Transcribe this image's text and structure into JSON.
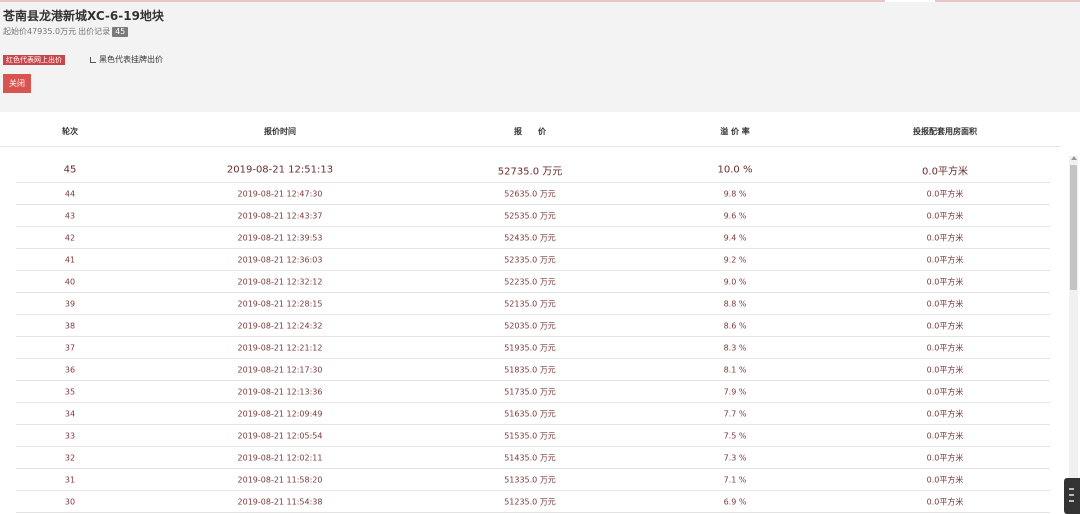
{
  "header": {
    "lot_title": "苍南县龙港新城XC-6-19地块",
    "start_price": "起始价47935.0万元",
    "bid_record_label": "出价记录",
    "bid_count": "45",
    "legend_red": "红色代表网上出价",
    "legend_black": "黑色代表挂牌出价",
    "close_label": "关闭"
  },
  "table": {
    "columns": [
      "轮次",
      "报价时间",
      "报　　价",
      "溢 价 率",
      "投报配套用房面积"
    ],
    "rows": [
      {
        "round": "45",
        "time": "2019-08-21 12:51:13",
        "price": "52735.0 万元",
        "rate": "10.0 %",
        "area": "0.0平方米"
      },
      {
        "round": "44",
        "time": "2019-08-21 12:47:30",
        "price": "52635.0 万元",
        "rate": "9.8 %",
        "area": "0.0平方米"
      },
      {
        "round": "43",
        "time": "2019-08-21 12:43:37",
        "price": "52535.0 万元",
        "rate": "9.6 %",
        "area": "0.0平方米"
      },
      {
        "round": "42",
        "time": "2019-08-21 12:39:53",
        "price": "52435.0 万元",
        "rate": "9.4 %",
        "area": "0.0平方米"
      },
      {
        "round": "41",
        "time": "2019-08-21 12:36:03",
        "price": "52335.0 万元",
        "rate": "9.2 %",
        "area": "0.0平方米"
      },
      {
        "round": "40",
        "time": "2019-08-21 12:32:12",
        "price": "52235.0 万元",
        "rate": "9.0 %",
        "area": "0.0平方米"
      },
      {
        "round": "39",
        "time": "2019-08-21 12:28:15",
        "price": "52135.0 万元",
        "rate": "8.8 %",
        "area": "0.0平方米"
      },
      {
        "round": "38",
        "time": "2019-08-21 12:24:32",
        "price": "52035.0 万元",
        "rate": "8.6 %",
        "area": "0.0平方米"
      },
      {
        "round": "37",
        "time": "2019-08-21 12:21:12",
        "price": "51935.0 万元",
        "rate": "8.3 %",
        "area": "0.0平方米"
      },
      {
        "round": "36",
        "time": "2019-08-21 12:17:30",
        "price": "51835.0 万元",
        "rate": "8.1 %",
        "area": "0.0平方米"
      },
      {
        "round": "35",
        "time": "2019-08-21 12:13:36",
        "price": "51735.0 万元",
        "rate": "7.9 %",
        "area": "0.0平方米"
      },
      {
        "round": "34",
        "time": "2019-08-21 12:09:49",
        "price": "51635.0 万元",
        "rate": "7.7 %",
        "area": "0.0平方米"
      },
      {
        "round": "33",
        "time": "2019-08-21 12:05:54",
        "price": "51535.0 万元",
        "rate": "7.5 %",
        "area": "0.0平方米"
      },
      {
        "round": "32",
        "time": "2019-08-21 12:02:11",
        "price": "51435.0 万元",
        "rate": "7.3 %",
        "area": "0.0平方米"
      },
      {
        "round": "31",
        "time": "2019-08-21 11:58:20",
        "price": "51335.0 万元",
        "rate": "7.1 %",
        "area": "0.0平方米"
      },
      {
        "round": "30",
        "time": "2019-08-21 11:54:38",
        "price": "51235.0 万元",
        "rate": "6.9 %",
        "area": "0.0平方米"
      }
    ]
  },
  "icons": {
    "scroll_up": "scroll-up-arrow-icon",
    "side_widget": "side-toolbar-icon"
  },
  "colors": {
    "accent_red": "#d9534f",
    "legend_red": "#c9464b",
    "row_text": "#7a3b3b",
    "header_bg": "#f4f3f3"
  }
}
